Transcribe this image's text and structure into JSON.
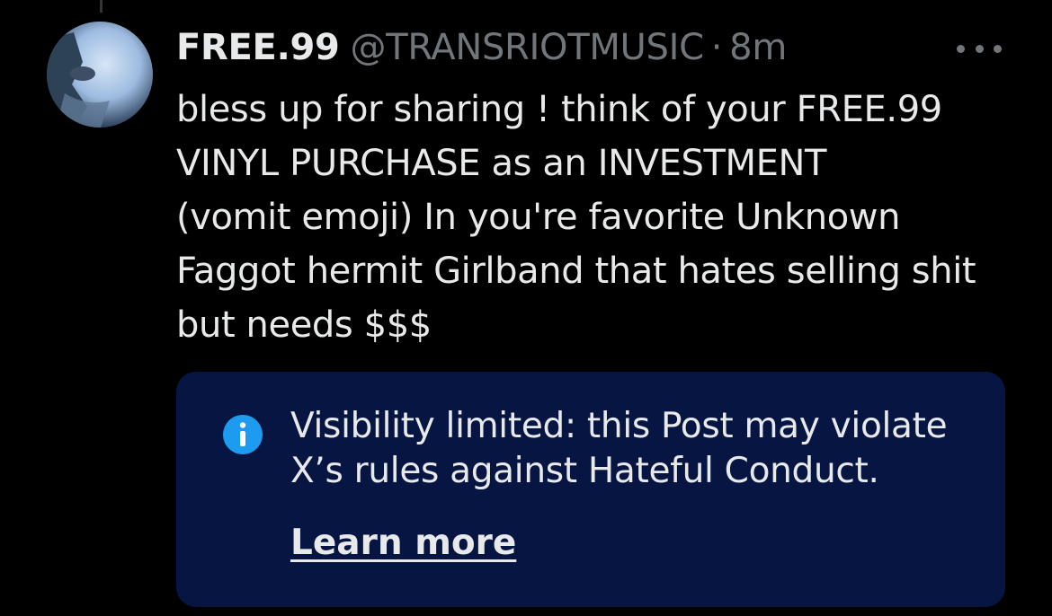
{
  "post": {
    "display_name": "FREE.99",
    "handle": "@TRANSRIOTMUSIC",
    "separator": "·",
    "time": "8m",
    "text_lines": [
      "bless up for sharing ! think of your FREE.99",
      "VINYL PURCHASE as an INVESTMENT",
      "(vomit emoji)  In you're favorite Unknown",
      "Faggot hermit Girlband that hates selling shit",
      "but needs $$$"
    ]
  },
  "notice": {
    "text_lines": [
      "Visibility limited: this Post may violate",
      "X’s rules against Hateful Conduct."
    ],
    "learn_more": "Learn more",
    "icon": "info-icon",
    "background": "#071542",
    "icon_color": "#1d9bf0"
  },
  "icons": {
    "more": "more-options-icon",
    "avatar": "avatar"
  }
}
